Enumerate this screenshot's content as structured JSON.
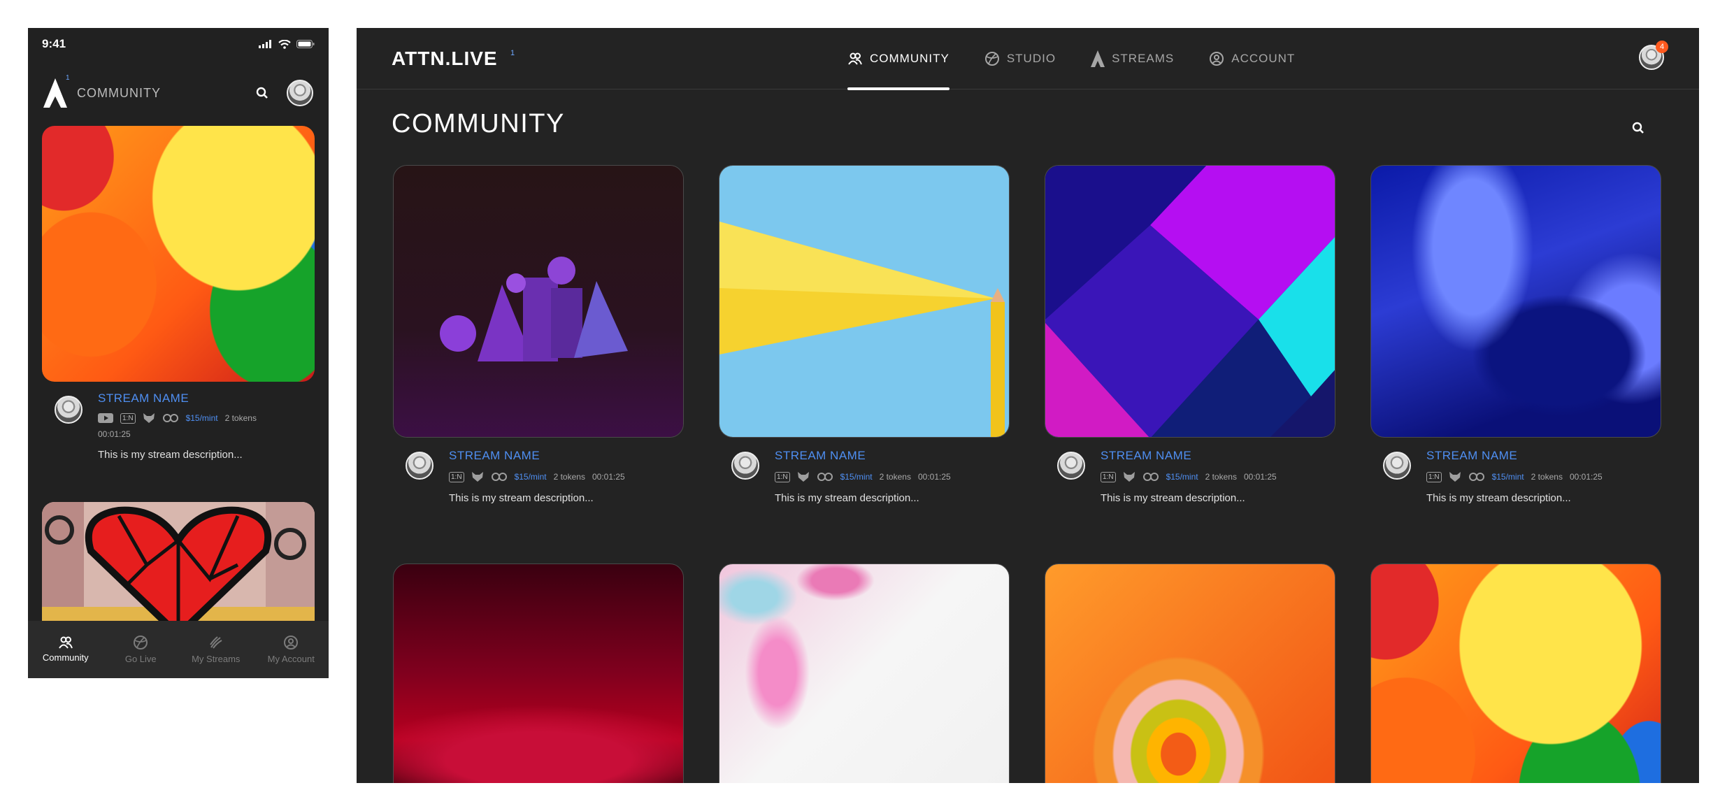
{
  "mobile": {
    "status": {
      "time": "9:41"
    },
    "header": {
      "title": "COMMUNITY",
      "logo_sup": "1"
    },
    "card": {
      "name": "STREAM NAME",
      "price": "$15/mint",
      "tokens": "2 tokens",
      "duration": "00:01:25",
      "description": "This is my stream description...",
      "ratio_label": "1:N"
    },
    "tabs": [
      {
        "label": "Community",
        "icon": "community-icon"
      },
      {
        "label": "Go Live",
        "icon": "globe-icon"
      },
      {
        "label": "My Streams",
        "icon": "streams-icon"
      },
      {
        "label": "My Account",
        "icon": "account-icon"
      }
    ]
  },
  "desktop": {
    "logo": "ATTN.LIVE",
    "logo_sup": "1",
    "nav": [
      {
        "label": "COMMUNITY",
        "icon": "community-icon",
        "active": true
      },
      {
        "label": "STUDIO",
        "icon": "globe-icon",
        "active": false
      },
      {
        "label": "STREAMS",
        "icon": "streams-icon",
        "active": false
      },
      {
        "label": "ACCOUNT",
        "icon": "account-icon",
        "active": false
      }
    ],
    "notifications": "4",
    "page_title": "COMMUNITY",
    "cards": [
      {
        "name": "STREAM NAME",
        "ratio_label": "1:N",
        "price": "$15/mint",
        "tokens": "2 tokens",
        "duration": "00:01:25",
        "description": "This is my stream description..."
      },
      {
        "name": "STREAM NAME",
        "ratio_label": "1:N",
        "price": "$15/mint",
        "tokens": "2 tokens",
        "duration": "00:01:25",
        "description": "This is my stream description..."
      },
      {
        "name": "STREAM NAME",
        "ratio_label": "1:N",
        "price": "$15/mint",
        "tokens": "2 tokens",
        "duration": "00:01:25",
        "description": "This is my stream description..."
      },
      {
        "name": "STREAM NAME",
        "ratio_label": "1:N",
        "price": "$15/mint",
        "tokens": "2 tokens",
        "duration": "00:01:25",
        "description": "This is my stream description..."
      }
    ]
  },
  "colors": {
    "accent": "#4f8ff2",
    "badge": "#ff5a1f",
    "background": "#232323"
  }
}
